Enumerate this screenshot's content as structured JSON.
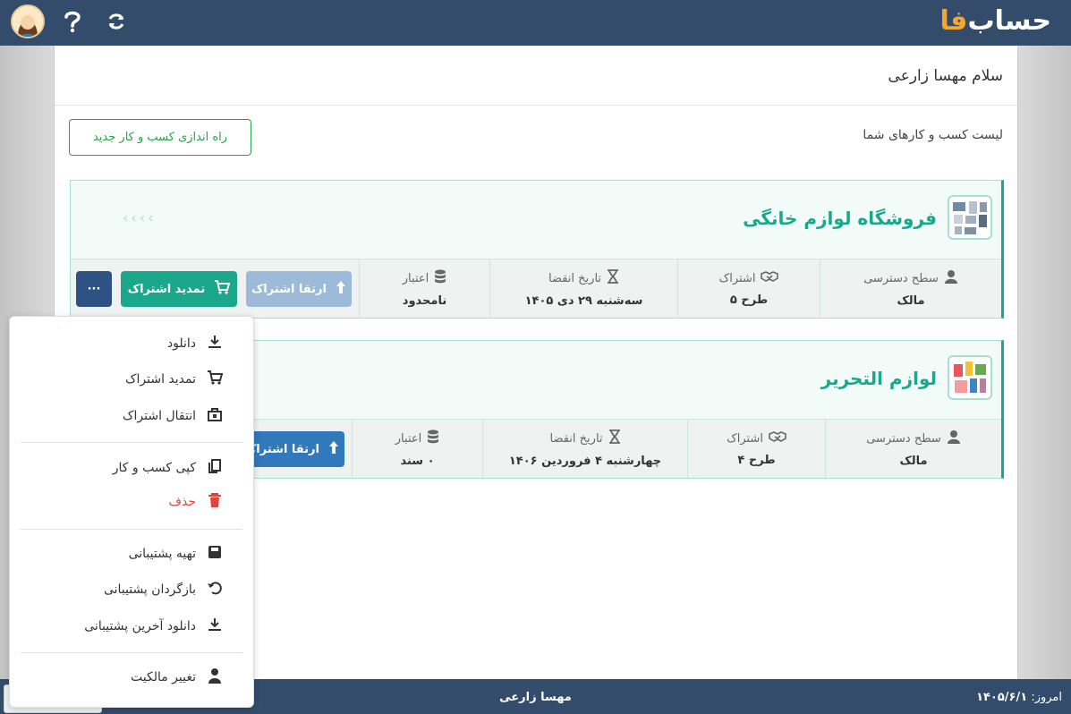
{
  "header": {
    "logo_main": "حساب",
    "logo_accent": "فا"
  },
  "greeting": "سلام مهسا زارعی",
  "list_title": "لیست کسب و کارهای شما",
  "new_business_label": "راه اندازی کسب و کار جدید",
  "businesses": [
    {
      "name": "فروشگاه لوازم خانگی",
      "chevrons": "‹‹‹‹",
      "fields": [
        {
          "label": "سطح دسترسی",
          "value": "مالک"
        },
        {
          "label": "اشتراک",
          "value": "طرح ۵"
        },
        {
          "label": "تاریخ انقضا",
          "value": "سه‌شنبه ۲۹ دی ۱۴۰۵"
        },
        {
          "label": "اعتبار",
          "value": "نامحدود"
        }
      ],
      "upgrade_label": "ارتقا اشتراک",
      "renew_label": "تمدید اشتراک",
      "more_label": "···"
    },
    {
      "name": "لوازم التحریر",
      "fields": [
        {
          "label": "سطح دسترسی",
          "value": "مالک"
        },
        {
          "label": "اشتراک",
          "value": "طرح ۴"
        },
        {
          "label": "تاریخ انقضا",
          "value": "چهارشنبه ۴ فروردین ۱۴۰۶"
        },
        {
          "label": "اعتبار",
          "value": "۰ سند"
        }
      ],
      "upgrade_label": "ارتقا اشتراک"
    }
  ],
  "menu": [
    {
      "label": "دانلود",
      "icon": "download-icon"
    },
    {
      "label": "تمدید اشتراک",
      "icon": "cart-icon"
    },
    {
      "label": "انتقال اشتراک",
      "icon": "transfer-icon"
    },
    {
      "label": "کپی کسب و کار",
      "icon": "copy-icon"
    },
    {
      "label": "حذف",
      "icon": "trash-icon"
    },
    {
      "label": "تهیه پشتیبانی",
      "icon": "save-icon"
    },
    {
      "label": "بازگردان پشتیبانی",
      "icon": "undo-icon"
    },
    {
      "label": "دانلود آخرین پشتیبانی",
      "icon": "download-icon"
    },
    {
      "label": "تغییر مالکیت",
      "icon": "user-icon"
    }
  ],
  "footer": {
    "user": "مهسا زارعی",
    "date_label": "امروز:",
    "date_value": "۱۴۰۵/۶/۱"
  },
  "colors": {
    "topbar": "#334c6b",
    "accent": "#1aa78c",
    "logo_accent": "#f6a72a",
    "danger": "#d9463b"
  }
}
